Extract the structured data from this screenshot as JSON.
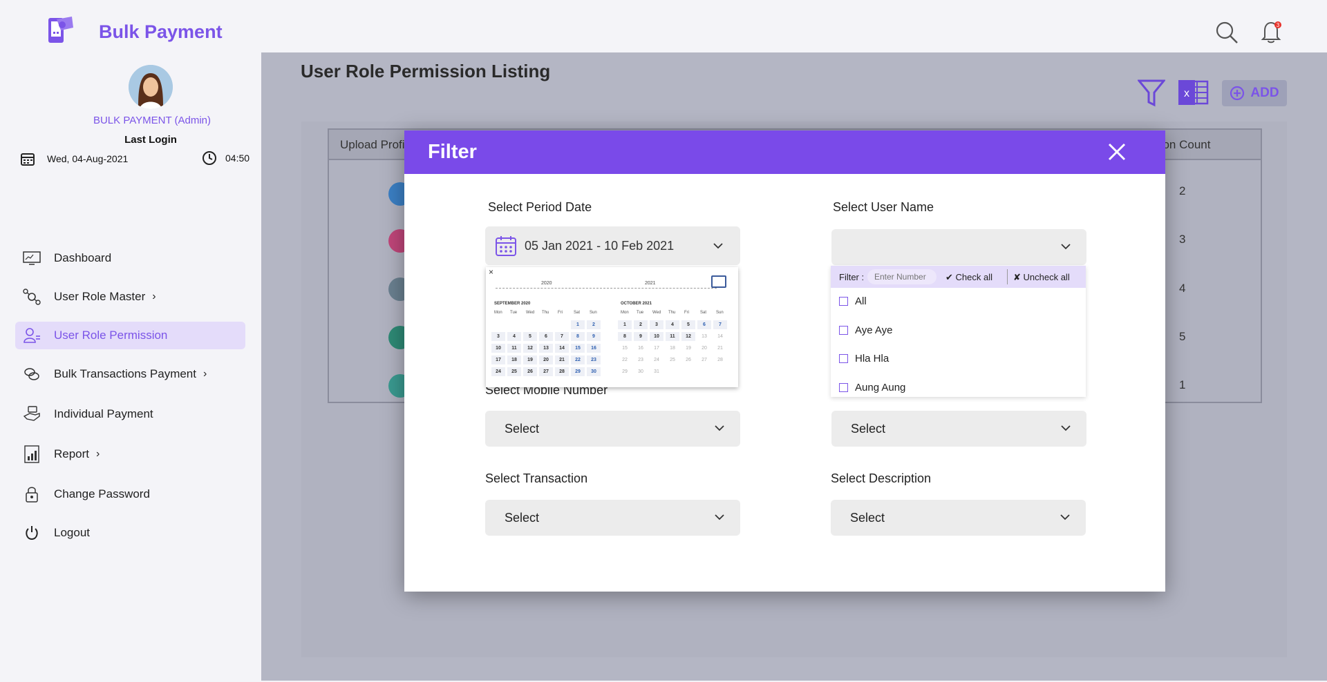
{
  "app": {
    "title": "Bulk Payment"
  },
  "user": {
    "name": "BULK PAYMENT (Admin)",
    "last_login_label": "Last Login",
    "date": "Wed, 04-Aug-2021",
    "time": "04:50"
  },
  "notifications": {
    "count": "3"
  },
  "sidebar": {
    "items": [
      {
        "label": "Dashboard",
        "icon": "dashboard-icon"
      },
      {
        "label": "User Role Master",
        "icon": "user-role-master-icon",
        "has_submenu": true
      },
      {
        "label": "User Role Permission",
        "icon": "user-permission-icon",
        "active": true
      },
      {
        "label": "Bulk Transactions Payment",
        "icon": "bulk-transactions-icon",
        "has_submenu": true
      },
      {
        "label": "Individual Payment",
        "icon": "individual-payment-icon"
      },
      {
        "label": "Report",
        "icon": "report-icon",
        "has_submenu": true
      },
      {
        "label": "Change Password",
        "icon": "lock-icon"
      },
      {
        "label": "Logout",
        "icon": "power-icon"
      }
    ]
  },
  "page": {
    "title": "User Role Permission Listing",
    "add_label": "ADD"
  },
  "table": {
    "col_first": "Upload Profi",
    "col_last": "action Count",
    "counts": [
      "2",
      "3",
      "4",
      "5",
      "1"
    ]
  },
  "filter": {
    "title": "Filter",
    "period_label": "Select Period Date",
    "period_value": "05 Jan 2021 - 10 Feb 2021",
    "username_label": "Select User Name",
    "mobile_label": "Select Mobile Number",
    "mobile_value": "Select",
    "username2_value": "Select",
    "transaction_label": "Select Transaction",
    "transaction_value": "Select",
    "description_label": "Select Description",
    "description_value": "Select"
  },
  "calendar": {
    "close": "×",
    "year_left": "2020",
    "year_right": "2021",
    "month_left": "SEPTEMBER 2020",
    "month_right": "OCTOBER 2021",
    "weekdays": [
      "Mon",
      "Tue",
      "Wed",
      "Thu",
      "Fri",
      "Sat",
      "Sun"
    ],
    "left_days": [
      "",
      "",
      "",
      "",
      "",
      "1",
      "2",
      "3",
      "4",
      "5",
      "6",
      "7",
      "8",
      "9",
      "10",
      "11",
      "12",
      "13",
      "14",
      "15",
      "16",
      "17",
      "18",
      "19",
      "20",
      "21",
      "22",
      "23",
      "24",
      "25",
      "26",
      "27",
      "28",
      "29",
      "30"
    ],
    "right_days": [
      "1",
      "2",
      "3",
      "4",
      "5",
      "6",
      "7",
      "8",
      "9",
      "10",
      "11",
      "12",
      "13",
      "14",
      "15",
      "16",
      "17",
      "18",
      "19",
      "20",
      "21",
      "22",
      "23",
      "24",
      "25",
      "26",
      "27",
      "28",
      "29",
      "30",
      "31"
    ]
  },
  "user_dropdown": {
    "filter_label": "Filter :",
    "filter_placeholder": "Enter Number",
    "check_all": "✔ Check all",
    "uncheck_all": "✘ Uncheck all",
    "options": [
      "All",
      "Aye Aye",
      "Hla Hla",
      "Aung Aung"
    ]
  },
  "colors": {
    "accent": "#7b54e8",
    "modal_header": "#7a4ae9"
  }
}
